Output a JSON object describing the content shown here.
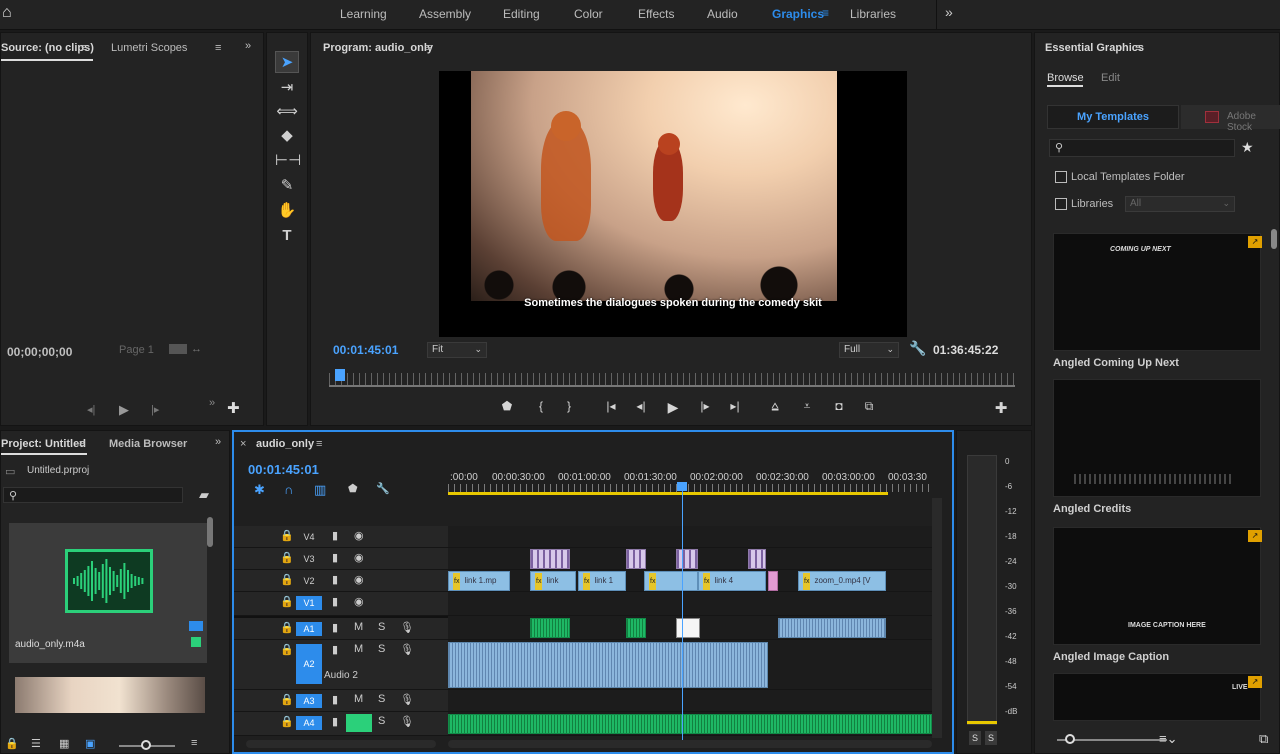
{
  "workspace": {
    "tabs": [
      "Learning",
      "Assembly",
      "Editing",
      "Color",
      "Effects",
      "Audio",
      "Graphics",
      "Libraries"
    ],
    "active": "Graphics",
    "more": "»"
  },
  "source_panel": {
    "title": "Source: (no clips)",
    "tab2": "Lumetri Scopes",
    "timecode": "00;00;00;00",
    "page": "Page 1"
  },
  "program": {
    "title": "Program: audio_only",
    "subtitle": "Sometimes the dialogues spoken during the comedy skit",
    "current_tc": "00:01:45:01",
    "fit": "Fit",
    "quality": "Full",
    "duration_tc": "01:36:45:22"
  },
  "essential_graphics": {
    "title": "Essential Graphics",
    "tabs": [
      "Browse",
      "Edit"
    ],
    "my_templates": "My Templates",
    "adobe_stock": "Adobe Stock",
    "local_templates": "Local Templates Folder",
    "libraries": "Libraries",
    "libraries_dropdown": "All",
    "templates": [
      {
        "name": "Angled Coming Up Next",
        "thumb_text": "COMING UP NEXT"
      },
      {
        "name": "Angled Credits",
        "thumb_text": ""
      },
      {
        "name": "Angled Image Caption",
        "thumb_text": "IMAGE CAPTION HERE"
      },
      {
        "name": "",
        "thumb_text": "LIVE"
      }
    ]
  },
  "project": {
    "title": "Project: Untitled",
    "tab2": "Media Browser",
    "file": "Untitled.prproj",
    "clip_name": "audio_only.m4a"
  },
  "timeline": {
    "title": "audio_only",
    "timecode": "00:01:45:01",
    "ruler": [
      ":00:00",
      "00:00:30:00",
      "00:01:00:00",
      "00:01:30:00",
      "00:02:00:00",
      "00:02:30:00",
      "00:03:00:00",
      "00:03:30"
    ],
    "tracks": [
      "V4",
      "V3",
      "V2",
      "V1",
      "A1",
      "A2",
      "A3",
      "A4"
    ],
    "audio2_label": "Audio 2",
    "m": "M",
    "s": "S",
    "v2_clips": [
      "link 1.mp",
      "link",
      "link 1",
      "",
      "link 4",
      "zoom_0.mp4 [V"
    ]
  },
  "meters": {
    "scale": [
      "0",
      "-6",
      "-12",
      "-18",
      "-24",
      "-30",
      "-36",
      "-42",
      "-48",
      "-54",
      "-dB"
    ],
    "solo": "S"
  },
  "colors": {
    "accent": "#2d8ceb",
    "audio_green": "#1eb865",
    "clip_blue": "#8dbfe4",
    "yellow": "#e8c800"
  }
}
